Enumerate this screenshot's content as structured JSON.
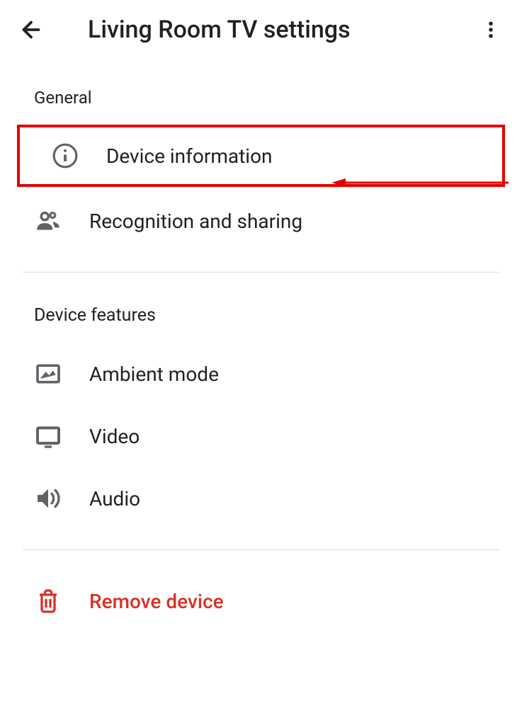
{
  "header": {
    "title": "Living Room TV settings"
  },
  "sections": {
    "general": {
      "title": "General",
      "items": [
        {
          "label": "Device information",
          "icon": "info"
        },
        {
          "label": "Recognition and sharing",
          "icon": "people"
        }
      ]
    },
    "features": {
      "title": "Device features",
      "items": [
        {
          "label": "Ambient mode",
          "icon": "image"
        },
        {
          "label": "Video",
          "icon": "monitor"
        },
        {
          "label": "Audio",
          "icon": "speaker"
        }
      ]
    },
    "danger": {
      "items": [
        {
          "label": "Remove device",
          "icon": "trash"
        }
      ]
    }
  },
  "colors": {
    "text": "#202124",
    "icon": "#5f6368",
    "danger": "#d93025",
    "highlight": "#e60000",
    "divider": "#dadce0"
  }
}
